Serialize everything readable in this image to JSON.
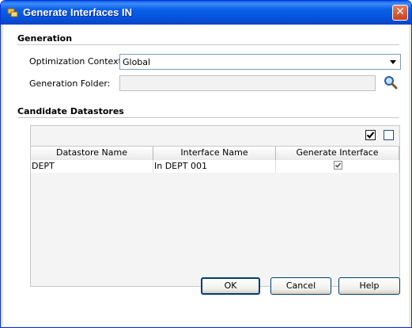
{
  "dialog": {
    "title": "Generate Interfaces IN",
    "close_glyph": "✕"
  },
  "generation": {
    "section_title": "Generation",
    "optimization_context_label": "Optimization Context:",
    "optimization_context_value": "Global",
    "generation_folder_label": "Generation Folder:",
    "generation_folder_value": ""
  },
  "candidates": {
    "section_title": "Candidate Datastores",
    "columns": [
      "Datastore Name",
      "Interface Name",
      "Generate Interface"
    ],
    "rows": [
      {
        "datastore": "DEPT",
        "interface": "In DEPT 001",
        "generate": true
      }
    ],
    "check_all_checked": true,
    "uncheck_all_checked": false
  },
  "buttons": {
    "ok": "OK",
    "cancel": "Cancel",
    "help": "Help"
  },
  "icons": {
    "title_icon": "app-icon",
    "search_icon": "magnifier-icon",
    "dropdown_icon": "chevron-down-icon"
  },
  "colors": {
    "title_bar": "#0553dd",
    "close_button": "#c8421f",
    "button_border": "#003c74"
  }
}
